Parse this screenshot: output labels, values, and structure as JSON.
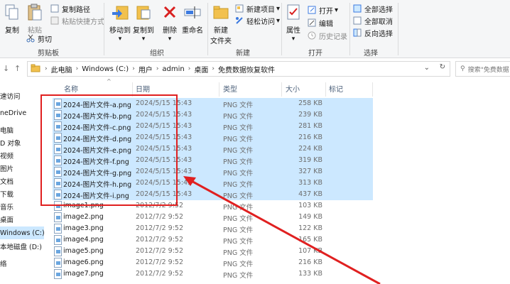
{
  "ribbon": {
    "clipboard": {
      "copy": "复制",
      "paste": "粘贴",
      "copy_path": "复制路径",
      "paste_shortcut": "粘贴快捷方式",
      "cut": "剪切",
      "group": "剪贴板"
    },
    "organize": {
      "move_to": "移动到",
      "copy_to": "复制到",
      "delete": "删除",
      "rename": "重命名",
      "group": "组织"
    },
    "new": {
      "new_folder": "新建",
      "new_folder_2": "文件夹",
      "new_item": "新建项目",
      "easy_access": "轻松访问",
      "group": "新建"
    },
    "open": {
      "properties": "属性",
      "open": "打开",
      "edit": "编辑",
      "history": "历史记录",
      "group": "打开"
    },
    "select": {
      "select_all": "全部选择",
      "select_none": "全部取消",
      "invert": "反向选择",
      "group": "选择"
    }
  },
  "address": {
    "crumbs": [
      "此电脑",
      "Windows (C:)",
      "用户",
      "admin",
      "桌面",
      "免费数据恢复软件"
    ],
    "search_placeholder": "搜索\"免费数据"
  },
  "nav": {
    "items": [
      {
        "label": "速访问",
        "selected": false
      },
      {
        "label": "neDrive",
        "selected": false
      },
      {
        "label": "电脑",
        "selected": false
      },
      {
        "label": "D 对象",
        "selected": false
      },
      {
        "label": "视频",
        "selected": false
      },
      {
        "label": "图片",
        "selected": false
      },
      {
        "label": "文档",
        "selected": false
      },
      {
        "label": "下载",
        "selected": false
      },
      {
        "label": "音乐",
        "selected": false
      },
      {
        "label": "桌面",
        "selected": false
      },
      {
        "label": "Windows (C:)",
        "selected": true
      },
      {
        "label": "本地磁盘 (D:)",
        "selected": false
      },
      {
        "label": "络",
        "selected": false
      }
    ]
  },
  "columns": {
    "name": "名称",
    "date": "日期",
    "type": "类型",
    "size": "大小",
    "tags": "标记"
  },
  "files": [
    {
      "name": "2024-图片文件-a.png",
      "date": "2024/5/15 15:43",
      "type": "PNG 文件",
      "size": "258 KB",
      "selected": true
    },
    {
      "name": "2024-图片文件-b.png",
      "date": "2024/5/15 15:43",
      "type": "PNG 文件",
      "size": "239 KB",
      "selected": true
    },
    {
      "name": "2024-图片文件-c.png",
      "date": "2024/5/15 15:43",
      "type": "PNG 文件",
      "size": "281 KB",
      "selected": true
    },
    {
      "name": "2024-图片文件-d.png",
      "date": "2024/5/15 15:43",
      "type": "PNG 文件",
      "size": "216 KB",
      "selected": true
    },
    {
      "name": "2024-图片文件-e.png",
      "date": "2024/5/15 15:43",
      "type": "PNG 文件",
      "size": "224 KB",
      "selected": true
    },
    {
      "name": "2024-图片文件-f.png",
      "date": "2024/5/15 15:43",
      "type": "PNG 文件",
      "size": "319 KB",
      "selected": true
    },
    {
      "name": "2024-图片文件-g.png",
      "date": "2024/5/15 15:43",
      "type": "PNG 文件",
      "size": "327 KB",
      "selected": true
    },
    {
      "name": "2024-图片文件-h.png",
      "date": "2024/5/15 15:43",
      "type": "PNG 文件",
      "size": "313 KB",
      "selected": true
    },
    {
      "name": "2024-图片文件-i.png",
      "date": "2024/5/15 15:43",
      "type": "PNG 文件",
      "size": "437 KB",
      "selected": true
    },
    {
      "name": "image1.png",
      "date": "2012/7/2 9:52",
      "type": "PNG 文件",
      "size": "103 KB",
      "selected": false
    },
    {
      "name": "image2.png",
      "date": "2012/7/2 9:52",
      "type": "PNG 文件",
      "size": "149 KB",
      "selected": false
    },
    {
      "name": "image3.png",
      "date": "2012/7/2 9:52",
      "type": "PNG 文件",
      "size": "122 KB",
      "selected": false
    },
    {
      "name": "image4.png",
      "date": "2012/7/2 9:52",
      "type": "PNG 文件",
      "size": "165 KB",
      "selected": false
    },
    {
      "name": "image5.png",
      "date": "2012/7/2 9:52",
      "type": "PNG 文件",
      "size": "107 KB",
      "selected": false
    },
    {
      "name": "image6.png",
      "date": "2012/7/2 9:52",
      "type": "PNG 文件",
      "size": "216 KB",
      "selected": false
    },
    {
      "name": "image7.png",
      "date": "2012/7/2 9:52",
      "type": "PNG 文件",
      "size": "133 KB",
      "selected": false
    }
  ],
  "colors": {
    "selection": "#cce8ff",
    "annotation": "#e02020",
    "accent_red": "#d92020",
    "folder_yellow": "#f2c14e"
  }
}
